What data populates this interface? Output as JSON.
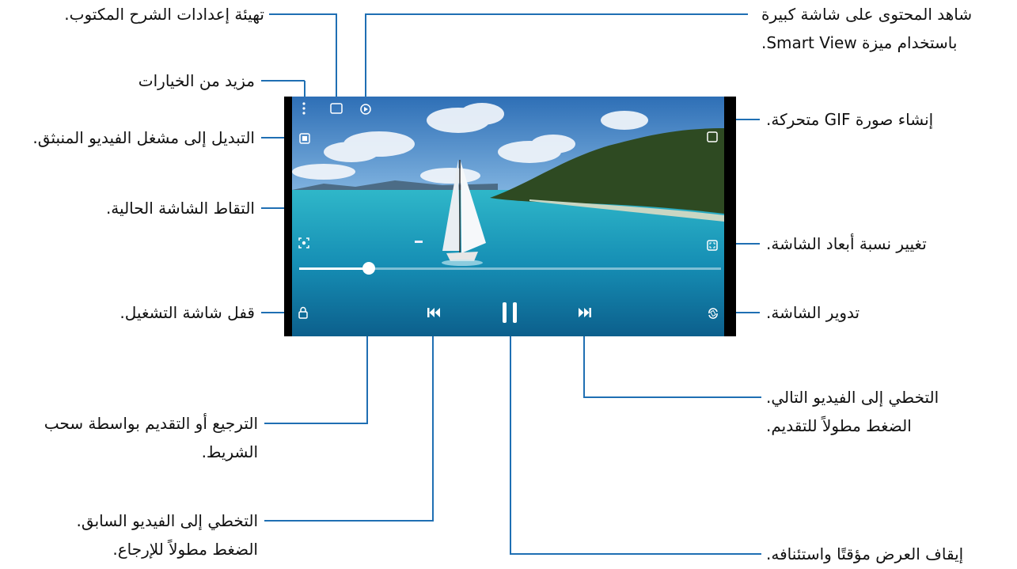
{
  "callouts": {
    "caption_settings": "تهيئة إعدادات الشرح المكتوب.",
    "smart_view_line1": "شاهد المحتوى على شاشة كبيرة",
    "smart_view_line2": "باستخدام ميزة Smart View.",
    "more_options": "مزيد من الخيارات",
    "popup_player": "التبديل إلى مشغل الفيديو المنبثق.",
    "gif": "إنشاء صورة GIF متحركة.",
    "capture": "التقاط الشاشة الحالية.",
    "aspect_ratio": "تغيير نسبة أبعاد الشاشة.",
    "lock": "قفل شاشة التشغيل.",
    "rotate": "تدوير الشاشة.",
    "seek_line1": "الترجيع أو التقديم بواسطة سحب",
    "seek_line2": "الشريط.",
    "next_line1": "التخطي إلى الفيديو التالي.",
    "next_line2": "الضغط مطولاً للتقديم.",
    "prev_line1": "التخطي إلى الفيديو السابق.",
    "prev_line2": "الضغط مطولاً للإرجاع.",
    "pause": "إيقاف العرض مؤقتًا واستئنافه."
  },
  "player": {
    "progress_fraction": 0.165,
    "icons": {
      "more": "more-vertical-icon",
      "caption": "caption-settings-icon",
      "smart_view": "smart-view-icon",
      "popup": "popup-player-icon",
      "gif": "gif-icon",
      "capture": "capture-icon",
      "ratio": "aspect-ratio-icon",
      "lock": "lock-icon",
      "rotate": "rotate-icon",
      "prev": "previous-icon",
      "pause": "pause-icon",
      "next": "next-icon"
    }
  },
  "colors": {
    "callout_line": "#1f6fb3",
    "sky": "#3b7fc4",
    "sea": "#1aa3bf"
  }
}
